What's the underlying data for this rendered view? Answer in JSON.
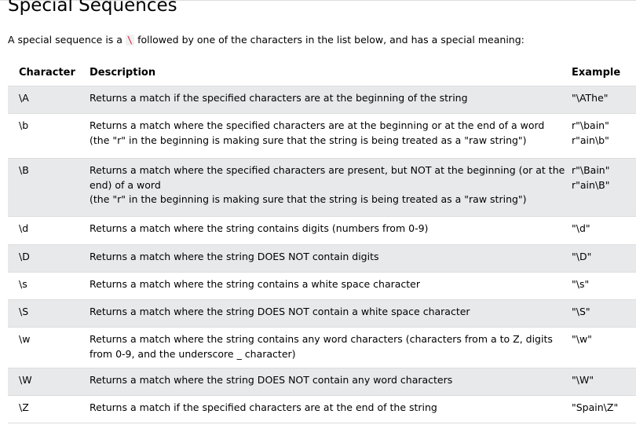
{
  "heading": "Special Sequences",
  "intro": {
    "before": "A special sequence is a ",
    "code": "\\",
    "after": " followed by one of the characters in the list below, and has a special meaning:"
  },
  "table": {
    "headers": {
      "character": "Character",
      "description": "Description",
      "example": "Example"
    },
    "rows": [
      {
        "character": "\\A",
        "description": [
          "Returns a match if the specified characters are at the beginning of the string"
        ],
        "example": [
          "\"\\AThe\""
        ]
      },
      {
        "character": "\\b",
        "description": [
          "Returns a match where the specified characters are at the beginning or at the end of a word",
          "(the \"r\" in the beginning is making sure that the string is being treated as a \"raw string\")"
        ],
        "example": [
          "r\"\\bain\"",
          "r\"ain\\b\""
        ]
      },
      {
        "character": "\\B",
        "description": [
          "Returns a match where the specified characters are present, but NOT at the beginning (or at the",
          "end) of a word",
          "(the \"r\" in the beginning is making sure that the string is being treated as a \"raw string\")"
        ],
        "example": [
          "r\"\\Bain\"",
          "r\"ain\\B\""
        ]
      },
      {
        "character": "\\d",
        "description": [
          "Returns a match where the string contains digits (numbers from 0-9)"
        ],
        "example": [
          "\"\\d\""
        ]
      },
      {
        "character": "\\D",
        "description": [
          "Returns a match where the string DOES NOT contain digits"
        ],
        "example": [
          "\"\\D\""
        ]
      },
      {
        "character": "\\s",
        "description": [
          "Returns a match where the string contains a white space character"
        ],
        "example": [
          "\"\\s\""
        ]
      },
      {
        "character": "\\S",
        "description": [
          "Returns a match where the string DOES NOT contain a white space character"
        ],
        "example": [
          "\"\\S\""
        ]
      },
      {
        "character": "\\w",
        "description": [
          "Returns a match where the string contains any word characters (characters from a to Z, digits",
          "from 0-9, and the underscore _ character)"
        ],
        "example": [
          "\"\\w\""
        ]
      },
      {
        "character": "\\W",
        "description": [
          "Returns a match where the string DOES NOT contain any word characters"
        ],
        "example": [
          "\"\\W\""
        ]
      },
      {
        "character": "\\Z",
        "description": [
          "Returns a match if the specified characters are at the end of the string"
        ],
        "example": [
          "\"Spain\\Z\""
        ]
      }
    ]
  }
}
